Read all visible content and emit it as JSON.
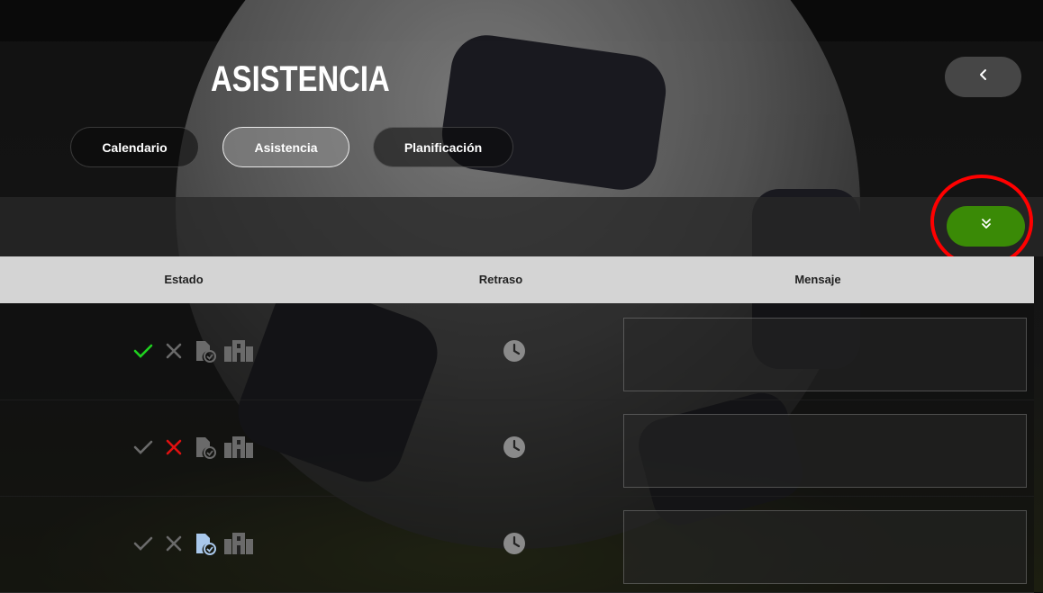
{
  "page": {
    "title": "ASISTENCIA"
  },
  "nav": {
    "back_icon": "chevron-left-icon"
  },
  "tabs": [
    {
      "label": "Calendario",
      "active": false
    },
    {
      "label": "Asistencia",
      "active": true
    },
    {
      "label": "Planificación",
      "active": false
    }
  ],
  "toolbar": {
    "confirm_icon": "double-check-icon",
    "confirm_color": "#3a8a06"
  },
  "table": {
    "headers": {
      "estado": "Estado",
      "retraso": "Retraso",
      "mensaje": "Mensaje"
    },
    "rows": [
      {
        "status": "present",
        "message": ""
      },
      {
        "status": "absent",
        "message": ""
      },
      {
        "status": "justified",
        "message": ""
      }
    ]
  },
  "colors": {
    "present": "#1fd11f",
    "absent": "#e01010",
    "justified": "#a9c8ec",
    "inactive": "#6a6a6a",
    "highlight_ring": "#ff0000"
  }
}
